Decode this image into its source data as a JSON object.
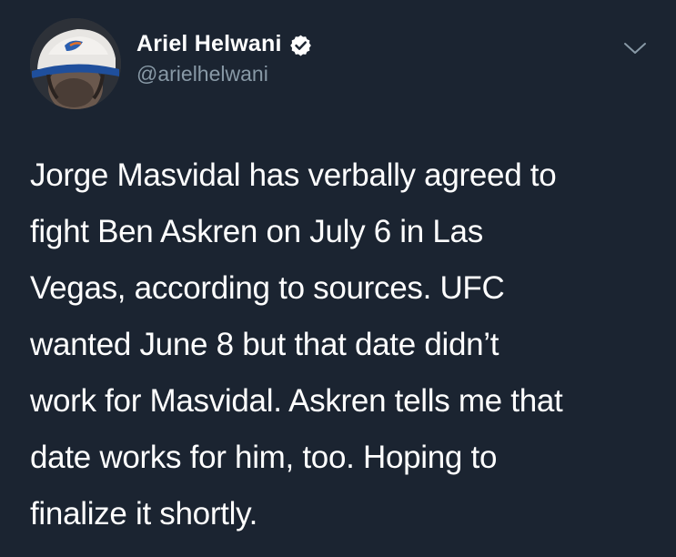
{
  "tweet": {
    "author": {
      "display_name": "Ariel Helwani",
      "handle": "@arielhelwani",
      "verified": true
    },
    "text": "Jorge Masvidal has verbally agreed to\nfight Ben Askren on July 6 in Las\nVegas, according to sources. UFC\nwanted June 8 but that date didn’t\nwork for Masvidal. Askren tells me that\ndate works for him, too. Hoping to\nfinalize it shortly."
  },
  "icons": {
    "verified": "verified-badge-icon",
    "menu": "chevron-down-icon"
  },
  "colors": {
    "background": "#1b2431",
    "text": "#ffffff",
    "secondary_text": "#8899a6",
    "verified_badge": "#ffffff"
  }
}
